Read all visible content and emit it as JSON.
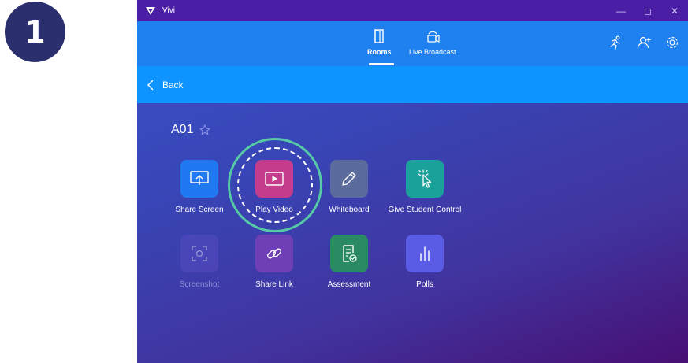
{
  "step": {
    "number": "1"
  },
  "window": {
    "title": "Vivi",
    "controls": [
      "minimize",
      "maximize",
      "close"
    ]
  },
  "nav": {
    "tabs": [
      {
        "label": "Rooms",
        "active": true
      },
      {
        "label": "Live Broadcast",
        "active": false
      }
    ]
  },
  "back": {
    "label": "Back"
  },
  "room": {
    "name": "A01"
  },
  "tiles": [
    {
      "label": "Share Screen",
      "color": "#2179f1",
      "icon": "share-screen-icon"
    },
    {
      "label": "Play Video",
      "color": "#c43c8b",
      "icon": "play-video-icon"
    },
    {
      "label": "Whiteboard",
      "color": "#5a6b9c",
      "icon": "pencil-icon"
    },
    {
      "label": "Give Student Control",
      "color": "#1aa19a",
      "icon": "cursor-click-icon"
    },
    {
      "label": "Screenshot",
      "color": "#5b4ec7",
      "icon": "screenshot-icon",
      "disabled": true
    },
    {
      "label": "Share Link",
      "color": "#6f3fb5",
      "icon": "link-icon"
    },
    {
      "label": "Assessment",
      "color": "#2a8a63",
      "icon": "assessment-icon"
    },
    {
      "label": "Polls",
      "color": "#5b5ce6",
      "icon": "polls-icon"
    }
  ],
  "highlighted_tile": "Play Video",
  "colors": {
    "titlebar": "#4b1fa5",
    "nav": "#1e81ef",
    "backbar": "#0f93ff",
    "highlight": "#56c9a5",
    "badge": "#2c2f6e"
  }
}
